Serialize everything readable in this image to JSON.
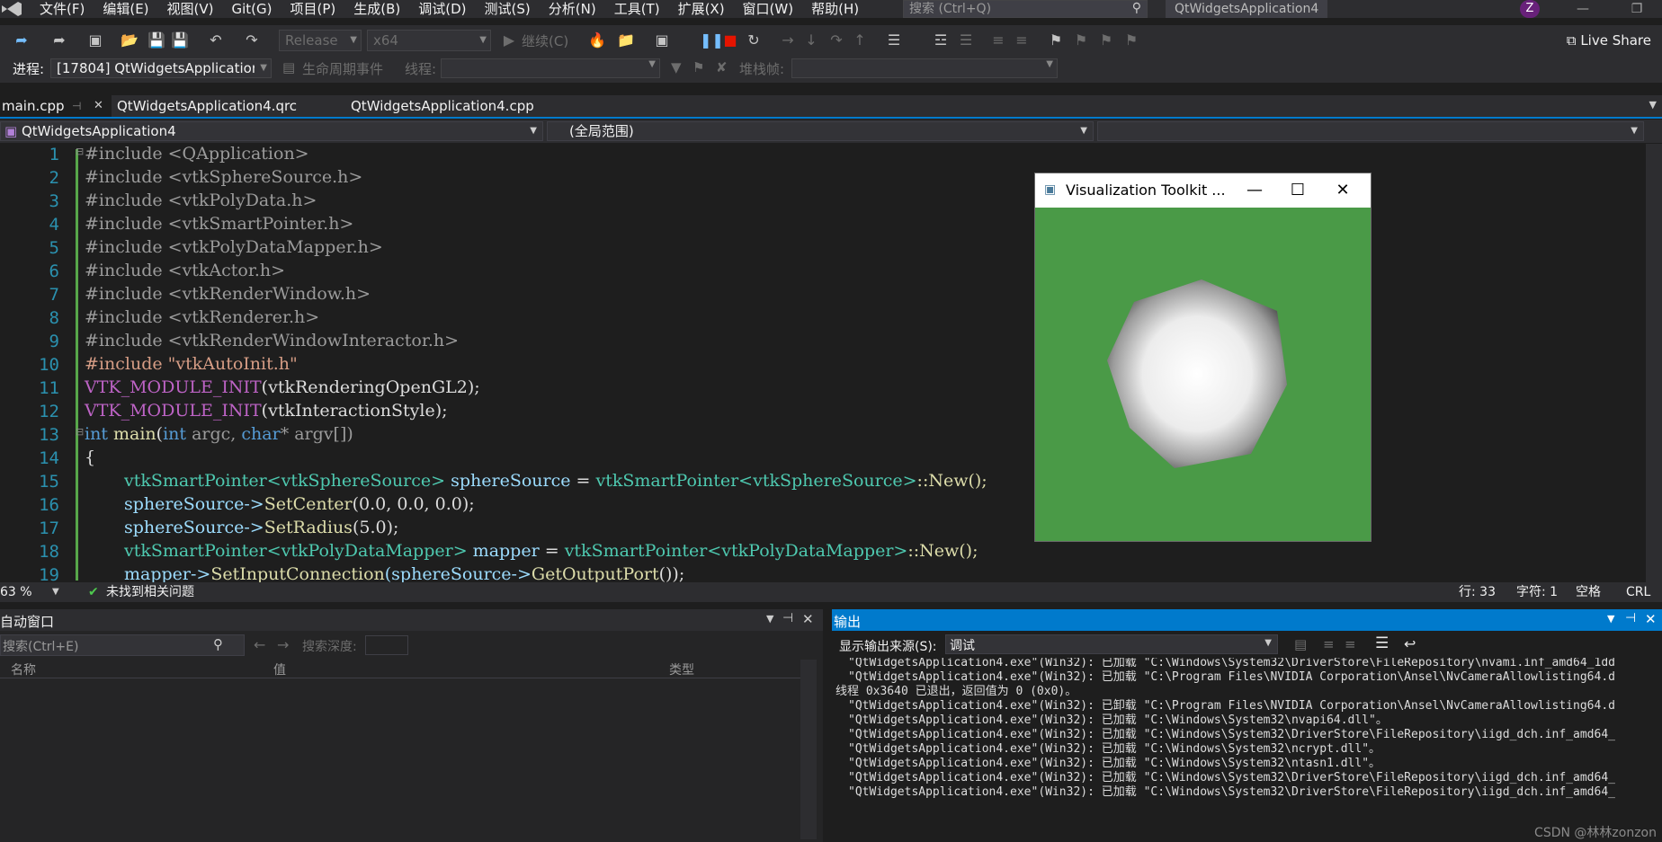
{
  "menu": {
    "items": [
      "文件(F)",
      "编辑(E)",
      "视图(V)",
      "Git(G)",
      "项目(P)",
      "生成(B)",
      "调试(D)",
      "测试(S)",
      "分析(N)",
      "工具(T)",
      "扩展(X)",
      "窗口(W)",
      "帮助(H)"
    ],
    "search_placeholder": "搜索 (Ctrl+Q)",
    "app_title": "QtWidgetsApplication4",
    "avatar_letter": "Z"
  },
  "toolbar": {
    "config": "Release",
    "platform": "x64",
    "continue_label": "继续(C)",
    "live_share": "Live Share"
  },
  "toolbar2": {
    "process_label": "进程:",
    "process_value": "[17804] QtWidgetsApplication4",
    "lifecycle_label": "生命周期事件",
    "thread_label": "线程:",
    "stackframe_label": "堆栈帧:"
  },
  "tabs": [
    {
      "label": "main.cpp",
      "active": true
    },
    {
      "label": "QtWidgetsApplication4.qrc",
      "active": false
    },
    {
      "label": "QtWidgetsApplication4.cpp",
      "active": false
    }
  ],
  "navbar": {
    "project": "QtWidgetsApplication4",
    "scope": "(全局范围)"
  },
  "code_lines": [
    "1",
    "2",
    "3",
    "4",
    "5",
    "6",
    "7",
    "8",
    "9",
    "10",
    "11",
    "12",
    "13",
    "14",
    "15",
    "16",
    "17",
    "18",
    "19"
  ],
  "code": {
    "l1": "#include <QApplication>",
    "l2": "#include <vtkSphereSource.h>",
    "l3": "#include <vtkPolyData.h>",
    "l4": "#include <vtkSmartPointer.h>",
    "l5": "#include <vtkPolyDataMapper.h>",
    "l6": "#include <vtkActor.h>",
    "l7": "#include <vtkRenderWindow.h>",
    "l8": "#include <vtkRenderer.h>",
    "l9": "#include <vtkRenderWindowInteractor.h>",
    "l10": "#include \"vtkAutoInit.h\"",
    "l11a": "VTK_MODULE_INIT",
    "l11b": "(vtkRenderingOpenGL2);",
    "l12a": "VTK_MODULE_INIT",
    "l12b": "(vtkInteractionStyle);",
    "l13a": "int",
    "l13b": "main",
    "l13c": "(",
    "l13d": "int",
    "l13e": " argc, ",
    "l13f": "char",
    "l13g": "* argv[])",
    "l14": "{",
    "l15a": "vtkSmartPointer<vtkSphereSource>",
    "l15b": " sphereSource",
    "l15c": " = ",
    "l15d": "vtkSmartPointer<vtkSphereSource>",
    "l15e": "::New();",
    "l16a": "sphereSource->",
    "l16b": "SetCenter",
    "l16c": "(0.0, 0.0, 0.0);",
    "l17a": "sphereSource->",
    "l17b": "SetRadius",
    "l17c": "(5.0);",
    "l18a": "vtkSmartPointer<vtkPolyDataMapper>",
    "l18b": " mapper",
    "l18c": " = ",
    "l18d": "vtkSmartPointer<vtkPolyDataMapper>",
    "l18e": "::New();",
    "l19a": "mapper->",
    "l19b": "SetInputConnection",
    "l19c": "(sphereSource->",
    "l19d": "GetOutputPort",
    "l19e": "());"
  },
  "vtk_window": {
    "title": "Visualization Toolkit ..."
  },
  "statusbar": {
    "zoom": "63 %",
    "issues": "未找到相关问题",
    "line": "行: 33",
    "char": "字符: 1",
    "space": "空格",
    "eol": "CRL"
  },
  "autos": {
    "title": "自动窗口",
    "search_placeholder": "搜索(Ctrl+E)",
    "depth_label": "搜索深度:",
    "col_name": "名称",
    "col_value": "值",
    "col_type": "类型"
  },
  "output": {
    "title": "输出",
    "source_label": "显示输出来源(S):",
    "source_value": "调试",
    "lines": [
      "\"QtWidgetsApplication4.exe\"(Win32): 已加载 \"C:\\Windows\\System32\\DriverStore\\FileRepository\\nvami.inf_amd64_1dd",
      "\"QtWidgetsApplication4.exe\"(Win32): 已加载 \"C:\\Program Files\\NVIDIA Corporation\\Ansel\\NvCameraAllowlisting64.d",
      "线程 0x3640 已退出，返回值为 0 (0x0)。",
      "\"QtWidgetsApplication4.exe\"(Win32): 已卸载 \"C:\\Program Files\\NVIDIA Corporation\\Ansel\\NvCameraAllowlisting64.d",
      "\"QtWidgetsApplication4.exe\"(Win32): 已加载 \"C:\\Windows\\System32\\nvapi64.dll\"。",
      "\"QtWidgetsApplication4.exe\"(Win32): 已加载 \"C:\\Windows\\System32\\DriverStore\\FileRepository\\iigd_dch.inf_amd64_",
      "\"QtWidgetsApplication4.exe\"(Win32): 已加载 \"C:\\Windows\\System32\\ncrypt.dll\"。",
      "\"QtWidgetsApplication4.exe\"(Win32): 已加载 \"C:\\Windows\\System32\\ntasn1.dll\"。",
      "\"QtWidgetsApplication4.exe\"(Win32): 已加载 \"C:\\Windows\\System32\\DriverStore\\FileRepository\\iigd_dch.inf_amd64_",
      "\"QtWidgetsApplication4.exe\"(Win32): 已加载 \"C:\\Windows\\System32\\DriverStore\\FileRepository\\iigd_dch.inf_amd64_"
    ],
    "watermark": "CSDN @林林zonzon"
  }
}
